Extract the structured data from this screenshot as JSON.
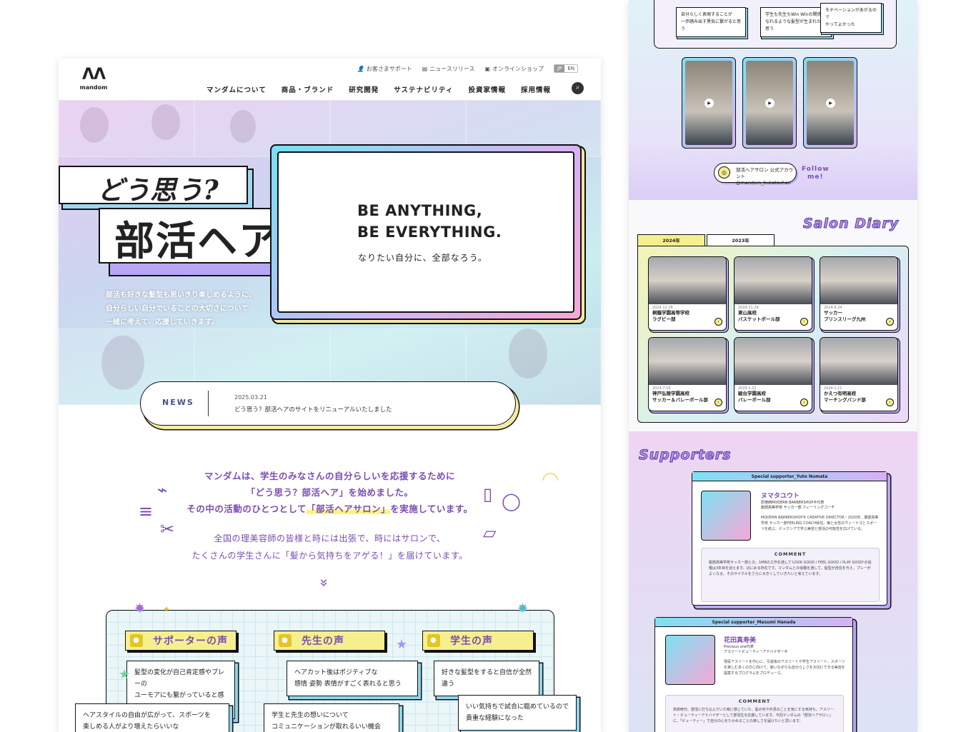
{
  "header": {
    "logo_mark": "ΛΛ",
    "logo_text": "mandom",
    "util": [
      "お客さまサポート",
      "ニュースリリース",
      "オンラインショップ"
    ],
    "lang_jp": "JP",
    "lang_en": "EN",
    "nav": [
      "マンダムについて",
      "商品・ブランド",
      "研究開発",
      "サステナビリティ",
      "投資家情報",
      "採用情報"
    ]
  },
  "hero": {
    "tag_small": "どう思う?",
    "tag_big": "部活ヘア",
    "lead": [
      "部活も好きな髪型も思いきり楽しめるように、",
      "自分らしい自分でいることの大切さについて",
      "一緒に考えて、応援していきます。"
    ],
    "en1": "BE ANYTHING,",
    "en2": "BE EVERYTHING.",
    "jp": "なりたい自分に、全部なろう。"
  },
  "news": {
    "label": "NEWS",
    "date": "2025.03.21",
    "title": "どう思う？部活ヘアのサイトをリニューアルいたしました"
  },
  "intro": {
    "l1": "マンダムは、学生のみなさんの自分らしいを応援するために",
    "l2": "「どう思う？部活ヘア」を始めました。",
    "l3a": "その中の活動のひとつとして",
    "l3b": "「部活ヘアサロン」",
    "l3c": "を実施しています。",
    "l4": "全国の理美容師の皆様と時には出張で、時にはサロンで、",
    "l5": "たくさんの学生さんに「髪から気持ちをアゲる！」を届けています。"
  },
  "voices": {
    "titles": [
      "サポーターの声",
      "先生の声",
      "学生の声"
    ],
    "cards": [
      "髪型の変化が自己肯定感やプレーの\nユーモアにも繋がっていると感じる",
      "ヘアカット後はポジティブな\n感情 姿勢 表情がすごく表れると思う",
      "好きな髪型をすると自信が全然違う",
      "ヘアスタイルの自由が広がって、スポーツを\n楽しめる人がより増えたらいいな",
      "学生と先生の想いについて\nコミュニケーションが取れるいい機会",
      "いい気持ちで試合に臨めているので\n貴重な経験になった"
    ]
  },
  "side": {
    "top_cards": [
      "自分らしく表現することが\n一歩踏み出す勇気に繋がると思う",
      "学生も先生もWin Winの関係に\nなれるような髪型が生まれたと思う",
      "モチベーションがあがるので\nやってよかった"
    ],
    "insta": "部活ヘアサロン 公式アカウント\n@mandom_bukatsuhair",
    "follow": "Follow\nme!",
    "diary_title": "Salon Diary",
    "tabs": [
      "2024年",
      "2023年"
    ],
    "diary": [
      {
        "d": "2024.12.26",
        "n": "桐蔭学園高等学校\nラグビー部"
      },
      {
        "d": "2024.11.29",
        "n": "東山高校\nバスケットボール部"
      },
      {
        "d": "2024.8.24",
        "n": "サッカー\nプリンスリーグ九州"
      },
      {
        "d": "2024.7.19",
        "n": "神戸弘陵学園高校\nサッカー＆バレーボール部"
      },
      {
        "d": "2024.1.22",
        "n": "駿台学園高校\nバレーボール部"
      },
      {
        "d": "2024.1.11",
        "n": "かえつ有明高校\nマーチングバンド部"
      }
    ],
    "sup_title": "Supporters",
    "sup1": {
      "bar": "Special supporter_Yuto Numata",
      "name": "ヌマタユウト",
      "role": "原宿西MODERN BARBERSHOP®代表\n服部高等学校 サッカー部 フィーリングコーチ",
      "bio": "MODERN BARBERSHOP® CREATIVE DIRECTOR・2020年、服部高等学校 サッカー部FEELING COACH就任。美と女性のヴィーナスとスポーツを結ぶ、ビックシアで学ぶ美容と部活の可能性を広げている。",
      "cm_h": "COMMENT",
      "cm": "服部高等学校サッカー部との、1MBの工作を通して'LOOK GOOD / FEEL GOOD / PLAY GOOD'の協働は3年目を迎えます。ほにめる存在です。マンダムとの協働を通して、髪型が自信を与え、プレーがよくなる。そのサイクルをさらに大きくしていきたいと考えています。"
    },
    "sup2": {
      "bar": "Special supporter_Masumi Hanada",
      "name": "花田真寿美",
      "role": "Precious one代表\nアスリートビューティーアドバイザー®",
      "bio": "現役アスリートを中心に、引退後のアスリートや学生アスリート、スポーツを楽しむ多くの方に向けて、競いながらも自分らしさを大切にできる美容を提案するプログラムをプロデュース。",
      "cm_h": "COMMENT",
      "cm": "高校時代、部活に打ち込んでいた時に感じていた、髪の毛や外見のことを気にする気持ち。アスリート・ビューティーアドバイザーとして部活生を応援しています。今回マンダムの「部活ヘアサロン」に、「ビューティー」で自分の心をたかめることの楽しさを届けたいと思います。"
    }
  }
}
